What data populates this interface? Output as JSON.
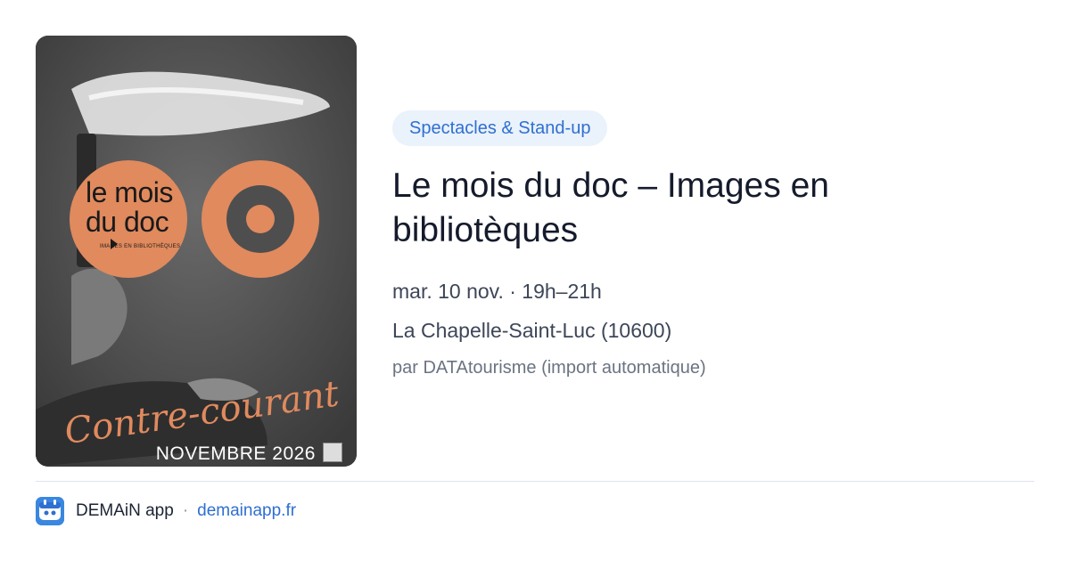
{
  "poster": {
    "logo_line1": "le mois",
    "logo_line2": "du doc",
    "logo_sub": "IMAGES EN BIBLIOTHÈQUES",
    "script_text": "Contre-courant",
    "caption": "NOVEMBRE 2026"
  },
  "event": {
    "category": "Spectacles & Stand-up",
    "title": "Le mois du doc – Images en bibliotèques",
    "when": "mar. 10 nov. · 19h–21h",
    "where": "La Chapelle-Saint-Luc (10600)",
    "by": "par DATAtourisme (import automatique)"
  },
  "footer": {
    "app_name": "DEMAiN app",
    "separator": "·",
    "domain": "demainapp.fr"
  },
  "colors": {
    "accent": "#2f6fd1",
    "chip_bg": "#eaf2fb",
    "poster_orange": "#e08a5e"
  },
  "icons": {
    "app": "demain-app-icon"
  }
}
